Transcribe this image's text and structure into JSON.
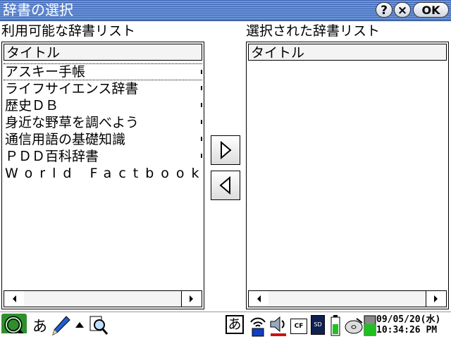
{
  "window": {
    "title": "辞書の選択",
    "help_label": "?",
    "close_label": "×",
    "ok_label": "OK"
  },
  "available": {
    "caption": "利用可能な辞書リスト",
    "column": "タイトル",
    "items": [
      "アスキー手帳",
      "ライフサイエンス辞書",
      "歴史ＤＢ",
      "身近な野草を調べよう",
      "通信用語の基礎知識",
      "ＰＤＤ百科辞書",
      "World Factbook"
    ],
    "selected_index": 0
  },
  "selected": {
    "caption": "選択された辞書リスト",
    "column": "タイトル",
    "items": []
  },
  "taskbar": {
    "input_mode": "あ",
    "ime_mode": "あ",
    "cf_label": "CF",
    "sd_label": "SD",
    "date": "09/05/20(水)",
    "time": "10:34:26 PM"
  }
}
